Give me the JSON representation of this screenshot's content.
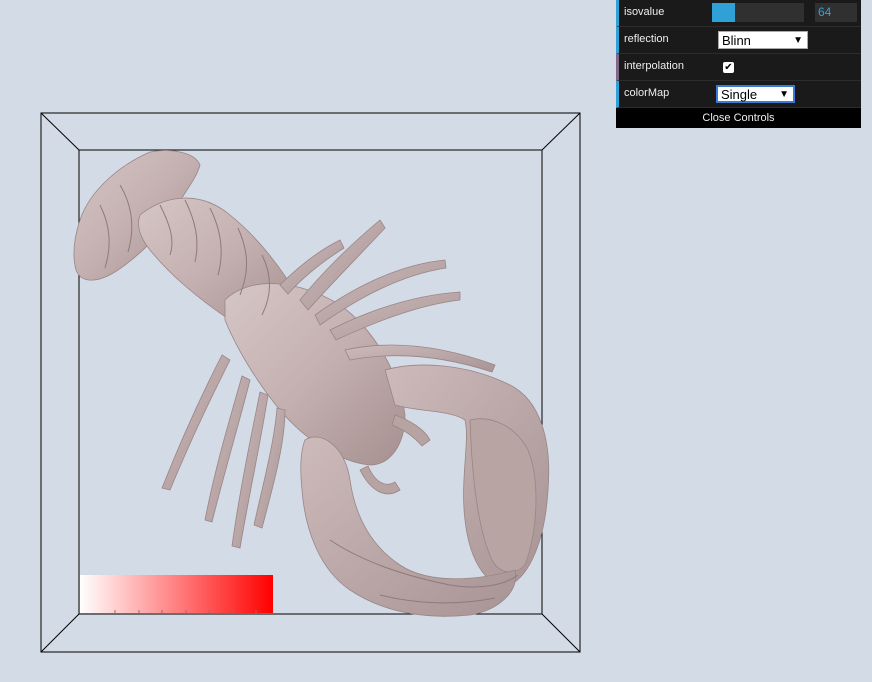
{
  "controls": {
    "isovalue": {
      "label": "isovalue",
      "value": "64",
      "fraction": 0.25
    },
    "reflection": {
      "label": "reflection",
      "selected": "Blinn"
    },
    "interpolation": {
      "label": "interpolation",
      "checked": true,
      "check_glyph": "✔"
    },
    "colorMap": {
      "label": "colorMap",
      "selected": "Single"
    },
    "close_label": "Close Controls"
  },
  "colors": {
    "background": "#d3dbe6",
    "surface": "#c7b4b4",
    "surface_shadow": "#a08c8c",
    "accent": "#2fa1d6",
    "colormap_start": "#ffffff",
    "colormap_end": "#ff0000"
  },
  "icons": {
    "dropdown_arrow": "▼"
  }
}
